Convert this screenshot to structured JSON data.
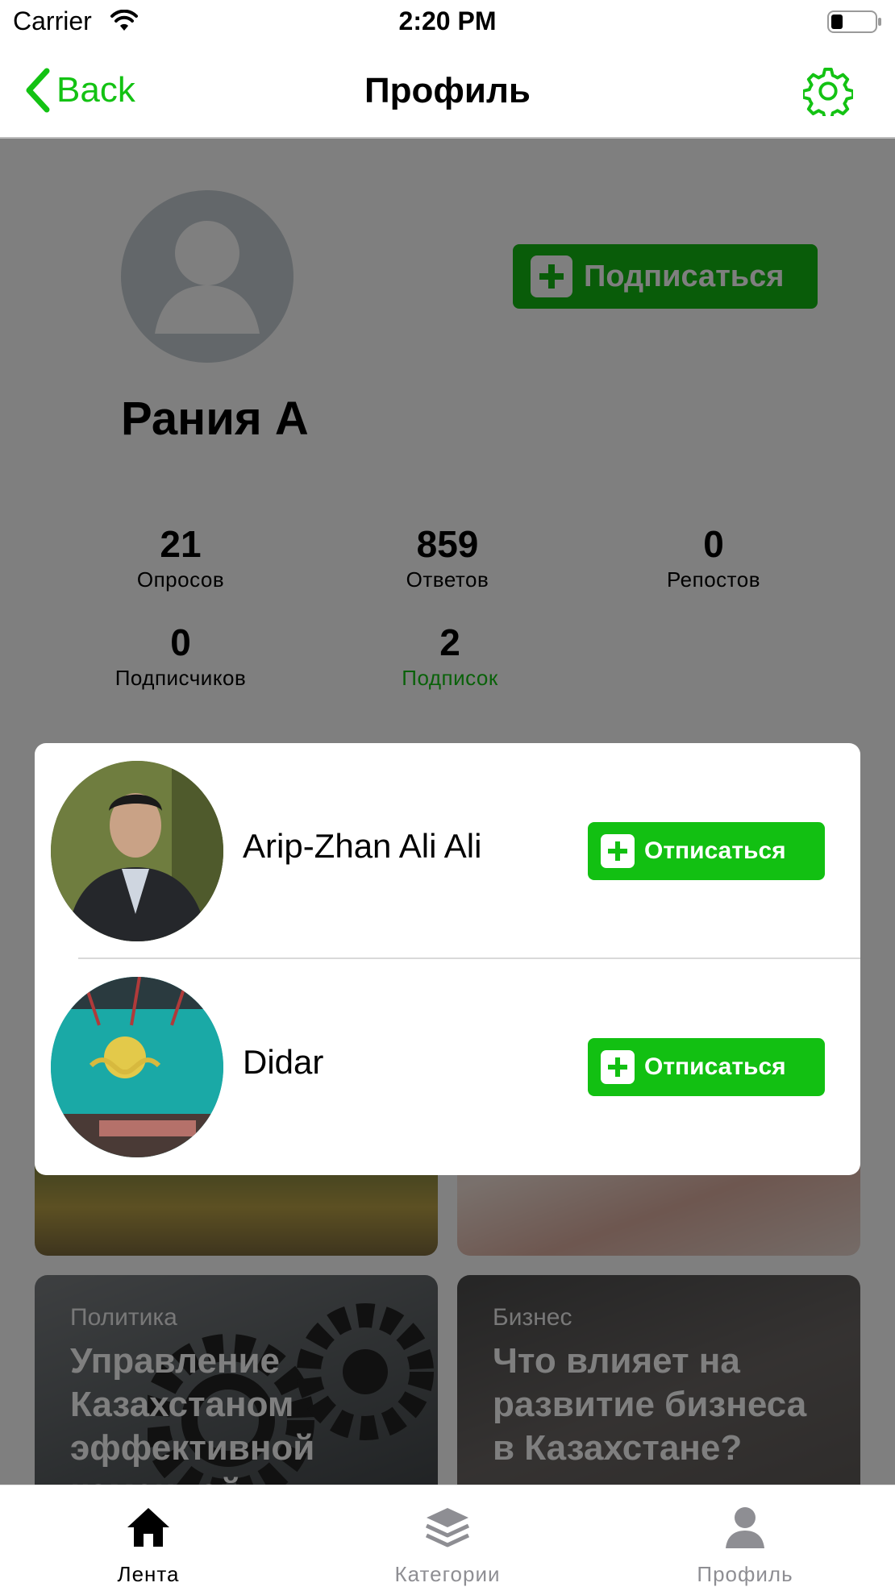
{
  "status_bar": {
    "carrier": "Carrier",
    "time": "2:20 PM"
  },
  "nav": {
    "back_label": "Back",
    "title": "Профиль"
  },
  "profile": {
    "name": "Рания А",
    "subscribe_label": "Подписаться",
    "stats": [
      {
        "value": "21",
        "label": "Опросов"
      },
      {
        "value": "859",
        "label": "Ответов"
      },
      {
        "value": "0",
        "label": "Репостов"
      },
      {
        "value": "0",
        "label": "Подписчиков"
      },
      {
        "value": "2",
        "label": "Подписок"
      }
    ]
  },
  "cards": [
    {
      "category": "Политика",
      "title": "Управление Казахстаном эффективной командой"
    },
    {
      "category": "Бизнес",
      "title": "Что влияет на развитие бизнеса в Казахстане?"
    }
  ],
  "subscriptions": [
    {
      "name": "Arip-Zhan Ali Ali",
      "button_label": "Отписаться"
    },
    {
      "name": "Didar",
      "button_label": "Отписаться"
    }
  ],
  "tabs": [
    {
      "label": "Лента",
      "icon": "home-icon",
      "active": true
    },
    {
      "label": "Категории",
      "icon": "layers-icon",
      "active": false
    },
    {
      "label": "Профиль",
      "icon": "user-icon",
      "active": false
    }
  ],
  "colors": {
    "accent": "#13c213",
    "button": "#12c012",
    "tab_inactive": "#8e8e93"
  }
}
